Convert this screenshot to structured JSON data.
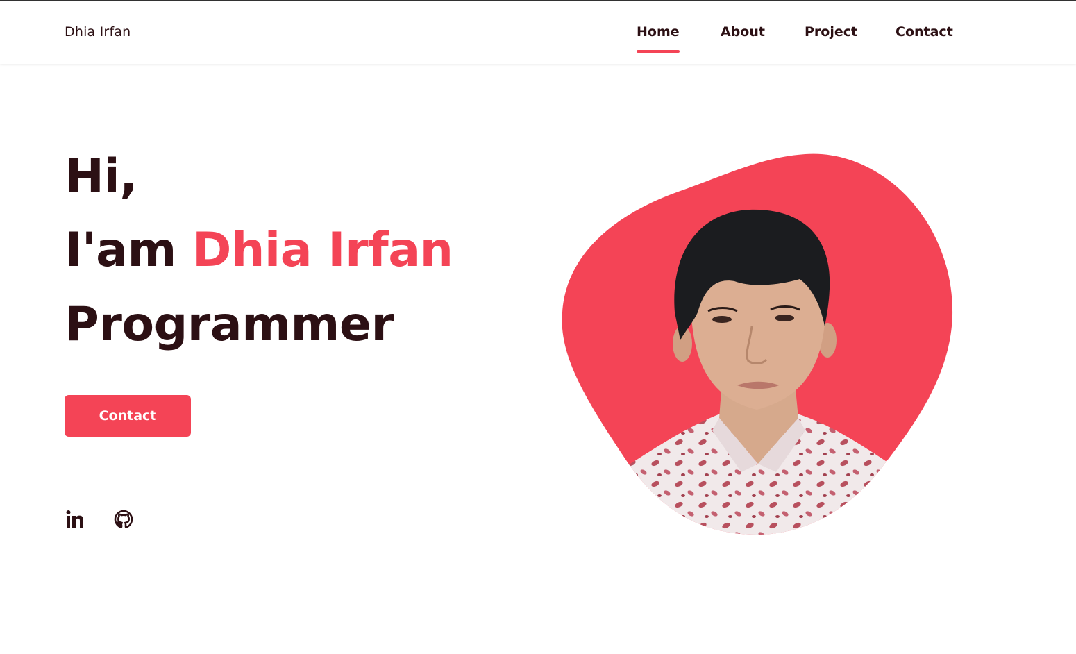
{
  "header": {
    "logo": "Dhia Irfan",
    "nav": [
      {
        "label": "Home",
        "active": true
      },
      {
        "label": "About",
        "active": false
      },
      {
        "label": "Project",
        "active": false
      },
      {
        "label": "Contact",
        "active": false
      }
    ]
  },
  "hero": {
    "line1": "Hi,",
    "line2_prefix": "I'am ",
    "line2_name": "Dhia Irfan",
    "line3": "Programmer",
    "button_label": "Contact",
    "socials": [
      {
        "name": "linkedin",
        "icon": "linkedin-icon"
      },
      {
        "name": "github",
        "icon": "github-icon"
      }
    ],
    "image": {
      "description_icon": "profile-photo"
    }
  },
  "colors": {
    "accent": "#f44456",
    "text_dark": "#2c1014",
    "background": "#ffffff"
  }
}
